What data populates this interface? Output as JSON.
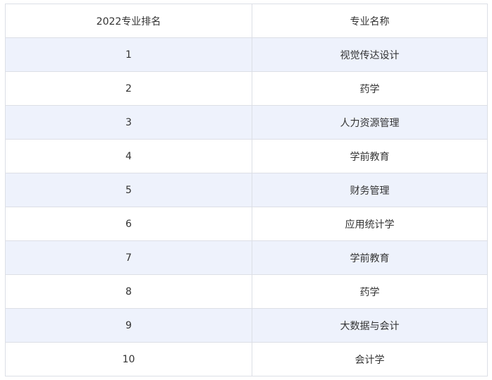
{
  "table": {
    "headers": [
      "2022专业排名",
      "专业名称"
    ],
    "rows": [
      {
        "rank": "1",
        "major": "视觉传达设计"
      },
      {
        "rank": "2",
        "major": "药学"
      },
      {
        "rank": "3",
        "major": "人力资源管理"
      },
      {
        "rank": "4",
        "major": "学前教育"
      },
      {
        "rank": "5",
        "major": "财务管理"
      },
      {
        "rank": "6",
        "major": "应用统计学"
      },
      {
        "rank": "7",
        "major": "学前教育"
      },
      {
        "rank": "8",
        "major": "药学"
      },
      {
        "rank": "9",
        "major": "大数据与会计"
      },
      {
        "rank": "10",
        "major": "会计学"
      }
    ],
    "colors": {
      "border": "#dcdfe6",
      "row_shade": "#eef2fc",
      "text": "#333333"
    }
  }
}
